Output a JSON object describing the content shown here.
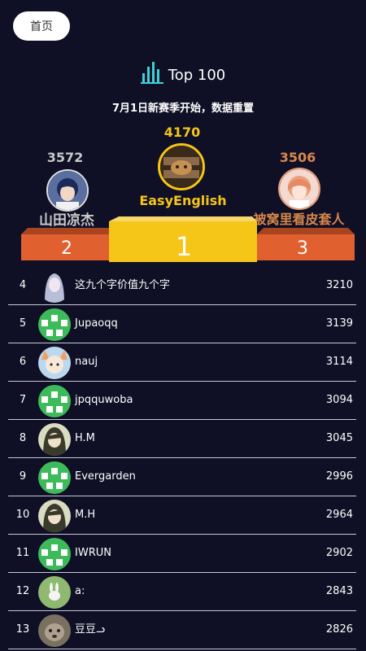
{
  "nav": {
    "home_label": "首页"
  },
  "header": {
    "title": "Top 100",
    "subtitle": "7月1日新赛季开始，数据重置"
  },
  "podium": {
    "first": {
      "rank": "1",
      "name": "EasyEnglish",
      "score": "4170",
      "color": "#f5c518"
    },
    "second": {
      "rank": "2",
      "name": "山田凉杰",
      "score": "3572",
      "color": "#c9c9c9"
    },
    "third": {
      "rank": "3",
      "name": "被窝里看皮套人",
      "score": "3506",
      "color": "#d8884a"
    }
  },
  "ranking": [
    {
      "rank": "4",
      "name": "这九个字价值九个字",
      "score": "3210",
      "avatar": "anime-silver-hair-icon"
    },
    {
      "rank": "5",
      "name": "Jupaoqq",
      "score": "3139",
      "avatar": "default-green-avatar-icon"
    },
    {
      "rank": "6",
      "name": "nauj",
      "score": "3114",
      "avatar": "anime-fox-girl-icon"
    },
    {
      "rank": "7",
      "name": "jpqquwoba",
      "score": "3094",
      "avatar": "default-green-avatar-icon"
    },
    {
      "rank": "8",
      "name": "H.M",
      "score": "3045",
      "avatar": "anime-dark-hair-icon"
    },
    {
      "rank": "9",
      "name": "Evergarden",
      "score": "2996",
      "avatar": "default-green-avatar-icon"
    },
    {
      "rank": "10",
      "name": "M.H",
      "score": "2964",
      "avatar": "anime-dark-hair-icon"
    },
    {
      "rank": "11",
      "name": "IWRUN",
      "score": "2902",
      "avatar": "default-green-avatar-icon"
    },
    {
      "rank": "12",
      "name": "a:",
      "score": "2843",
      "avatar": "rabbit-sketch-icon"
    },
    {
      "rank": "13",
      "name": "豆豆ᓗ",
      "score": "2826",
      "avatar": "dog-photo-icon"
    }
  ]
}
